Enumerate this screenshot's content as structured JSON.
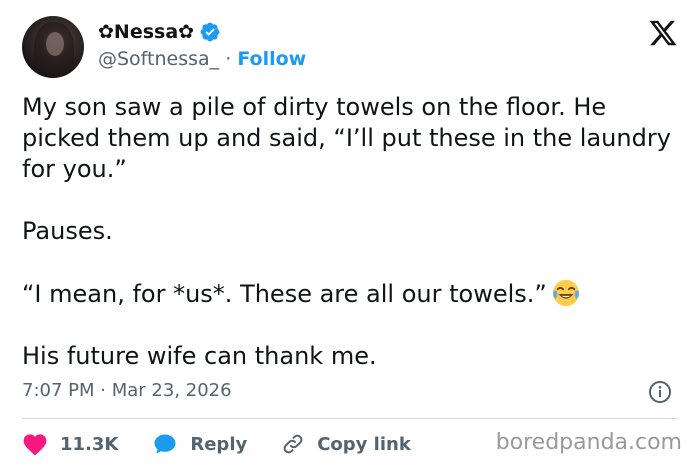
{
  "author": {
    "display_name": "✿Nessa✿",
    "handle": "@Softnessa_",
    "separator": "·",
    "follow_label": "Follow"
  },
  "tweet": {
    "line1": "My son saw a pile of dirty towels on the floor. He picked them up and said, “I’ll put these in the laundry for you.”",
    "line2": "Pauses.",
    "line3": "“I mean, for *us*. These are all our towels.”",
    "line4": "His future wife can thank me.",
    "emoji": "joy-emoji"
  },
  "meta": {
    "time": "7:07 PM",
    "separator": "·",
    "date": "Mar 23, 2026"
  },
  "actions": {
    "likes": "11.3K",
    "reply_label": "Reply",
    "copy_link_label": "Copy link"
  },
  "watermark": "boredpanda.com",
  "colors": {
    "text": "#0f1419",
    "secondary": "#536471",
    "accent": "#1d9bf0",
    "like": "#f91880",
    "divider": "#cfd9de"
  }
}
